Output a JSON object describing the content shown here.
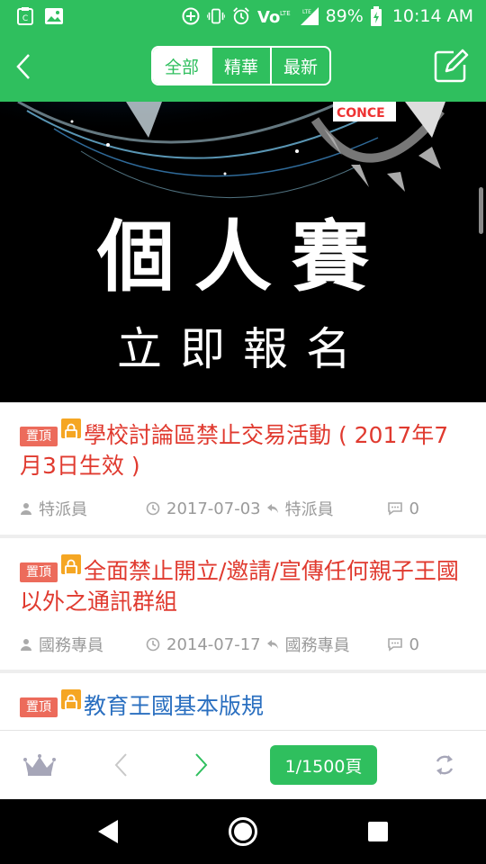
{
  "status_bar": {
    "battery": "89%",
    "time": "10:14 AM",
    "icons": [
      "clipboard-icon",
      "image-icon",
      "add-circle-icon",
      "vibrate-icon",
      "alarm-icon",
      "volte-icon",
      "wifi-icon",
      "signal-icon",
      "battery-icon"
    ]
  },
  "nav": {
    "tabs": [
      {
        "label": "全部",
        "active": true
      },
      {
        "label": "精華",
        "active": false
      },
      {
        "label": "最新",
        "active": false
      }
    ]
  },
  "banner": {
    "title": "個人賽",
    "subtitle": "立即報名"
  },
  "posts": [
    {
      "badge": "置頂",
      "title": "學校討論區禁止交易活動 ( 2017年7月3日生效 )",
      "author": "特派員",
      "date": "2017-07-03",
      "last_reply": "特派員",
      "replies": "0",
      "color": "#e03a2f"
    },
    {
      "badge": "置頂",
      "title": "全面禁止開立/邀請/宣傳任何親子王國以外之通訊群組",
      "author": "國務專員",
      "date": "2014-07-17",
      "last_reply": "國務專員",
      "replies": "0",
      "color": "#e03a2f"
    },
    {
      "badge": "置頂",
      "title": "教育王國基本版規",
      "color": "#2a6fc0"
    }
  ],
  "toolbar": {
    "page_indicator": "1/1500頁"
  },
  "colors": {
    "brand_green": "#2fbf5e",
    "pin_badge": "#ec6b5b",
    "lock_badge": "#f5a623"
  }
}
